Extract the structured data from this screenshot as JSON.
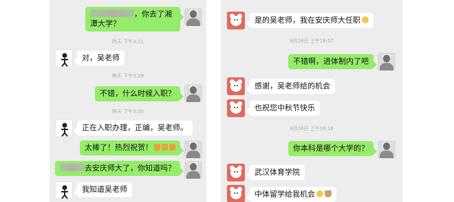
{
  "left_chat": {
    "messages": [
      {
        "text": "，你去了湘潭大学？"
      },
      {
        "text": "对，吴老师"
      },
      {
        "text": "不错，什么时候入职？"
      },
      {
        "text": "正在入职办理，正编，吴老师。"
      },
      {
        "text": "太棒了！热烈祝贺！"
      },
      {
        "text": "去安庆师大了，你知道吗？"
      },
      {
        "text": "我知道吴老师"
      }
    ],
    "timestamps": [
      "昨天 下午3:21",
      "昨天 下午3:29",
      "昨天 下午3:35"
    ]
  },
  "right_chat": {
    "messages": [
      {
        "text": "是的吴老师，我在安庆师大任职"
      },
      {
        "text": "不错啊，进体制内了吧"
      },
      {
        "text": "感谢，吴老师给的机会"
      },
      {
        "text": "也祝您中秋节快乐"
      },
      {
        "text": "你本科是哪个大学的？"
      },
      {
        "text": "武汉体育学院"
      },
      {
        "text": "中体留学给我机会"
      }
    ],
    "timestamps": [
      "9月28日 上午18:57",
      "9月28日 上午19:18"
    ]
  },
  "icons": [
    "man-avatar-icon",
    "stick-figure-avatar-icon",
    "bear-avatar-icon",
    "cheer-emoji-icon",
    "smile-emoji-icon",
    "tea-emoji-icon"
  ]
}
